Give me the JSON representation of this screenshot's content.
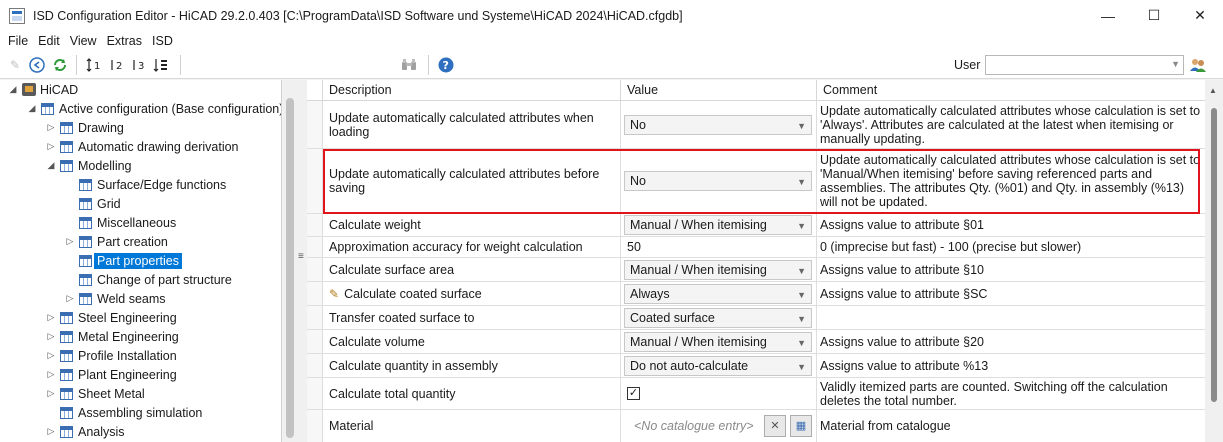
{
  "window": {
    "title": "ISD Configuration Editor  -  HiCAD 29.2.0.403 [C:\\ProgramData\\ISD Software und Systeme\\HiCAD 2024\\HiCAD.cfgdb]",
    "minimize_glyph": "—",
    "maximize_glyph": "☐",
    "close_glyph": "✕"
  },
  "menu": [
    "File",
    "Edit",
    "View",
    "Extras",
    "ISD"
  ],
  "toolbar": {
    "user_label": "User",
    "user_value": "",
    "icons": [
      "pencil-icon",
      "back-icon",
      "refresh-icon",
      "level-1-icon",
      "level-2-icon",
      "level-3-icon",
      "sort-icon",
      "binoculars-icon",
      "help-icon",
      "users-icon"
    ]
  },
  "tree": {
    "root": "HiCAD",
    "active": "Active configuration (Base configuration)",
    "items": [
      {
        "label": "Drawing",
        "expander": "▷"
      },
      {
        "label": "Automatic drawing derivation",
        "expander": "▷"
      },
      {
        "label": "Modelling",
        "expander": "◢"
      },
      {
        "label": "Surface/Edge functions",
        "expander": ""
      },
      {
        "label": "Grid",
        "expander": ""
      },
      {
        "label": "Miscellaneous",
        "expander": ""
      },
      {
        "label": "Part creation",
        "expander": "▷"
      },
      {
        "label": "Part properties",
        "expander": "",
        "selected": true
      },
      {
        "label": "Change of part structure",
        "expander": ""
      },
      {
        "label": "Weld seams",
        "expander": "▷"
      },
      {
        "label": "Steel Engineering",
        "expander": "▷"
      },
      {
        "label": "Metal Engineering",
        "expander": "▷"
      },
      {
        "label": "Profile Installation",
        "expander": "▷"
      },
      {
        "label": "Plant Engineering",
        "expander": "▷"
      },
      {
        "label": "Sheet Metal",
        "expander": "▷"
      },
      {
        "label": "Assembling simulation",
        "expander": ""
      },
      {
        "label": "Analysis",
        "expander": "▷"
      }
    ]
  },
  "grid": {
    "headers": [
      "Description",
      "Value",
      "Comment"
    ],
    "rows": [
      {
        "desc": "Update automatically calculated attributes when loading",
        "type": "combo",
        "value": "No",
        "comment": "Update automatically calculated attributes whose calculation is set to 'Always'. Attributes are calculated at the latest when itemising or manually updating."
      },
      {
        "desc": "Update automatically calculated attributes before saving",
        "type": "combo",
        "value": "No",
        "comment": "Update automatically calculated attributes whose calculation is set to 'Manual/When itemising' before saving referenced parts and assemblies. The attributes Qty. (%01) and Qty. in assembly (%13) will not be updated."
      },
      {
        "desc": "Calculate weight",
        "type": "combo",
        "value": "Manual / When itemising",
        "comment": "Assigns value to attribute §01"
      },
      {
        "desc": "Approximation accuracy for weight calculation",
        "type": "text",
        "value": "50",
        "comment": "0 (imprecise but fast) - 100 (precise but slower)"
      },
      {
        "desc": "Calculate surface area",
        "type": "combo",
        "value": "Manual / When itemising",
        "comment": "Assigns value to attribute §10"
      },
      {
        "desc": "Calculate coated surface",
        "type": "combo",
        "value": "Always",
        "comment": "Assigns value to attribute §SC",
        "pencil": true
      },
      {
        "desc": "Transfer coated surface to",
        "type": "combo",
        "value": "Coated surface",
        "comment": ""
      },
      {
        "desc": "Calculate volume",
        "type": "combo",
        "value": "Manual / When itemising",
        "comment": "Assigns value to attribute §20"
      },
      {
        "desc": "Calculate quantity in assembly",
        "type": "combo",
        "value": "Do not auto-calculate",
        "comment": "Assigns value to attribute %13"
      },
      {
        "desc": "Calculate total quantity",
        "type": "check",
        "value": "✓",
        "comment": "Validly itemized parts are counted. Switching off the calculation deletes the total number."
      },
      {
        "desc": "Material",
        "type": "catalogue",
        "value": "<No catalogue entry>",
        "comment": "Material from catalogue"
      }
    ]
  },
  "colors": {
    "selection": "#0078d7",
    "highlight_box": "#e0141a"
  }
}
